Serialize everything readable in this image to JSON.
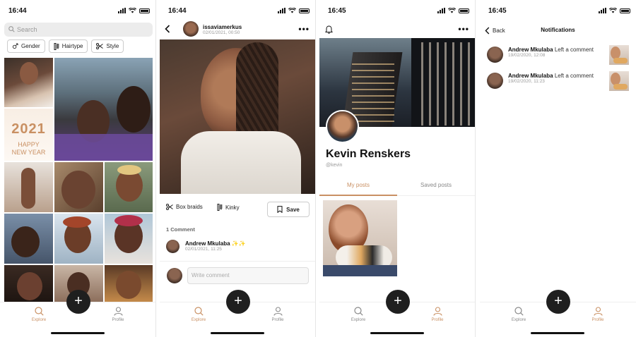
{
  "screens": {
    "explore": {
      "status_time": "16:44",
      "search_placeholder": "Search",
      "filters": [
        "Gender",
        "Hairtype",
        "Style"
      ],
      "banner_year": "2021",
      "banner_line1": "HAPPY",
      "banner_line2": "NEW YEAR"
    },
    "post": {
      "status_time": "16:44",
      "username": "issaviamerkus",
      "date": "02/01/2021, 00:50",
      "tags": [
        "Box braids",
        "Kinky"
      ],
      "save_label": "Save",
      "comments_count": "1 Comment",
      "comment": {
        "author": "Andrew Mkulaba",
        "text": "✨✨",
        "date": "02/01/2021, 11:25"
      },
      "write_placeholder": "Write comment"
    },
    "profile": {
      "status_time": "16:45",
      "name": "Kevin Renskers",
      "handle": "@kevin",
      "tabs": [
        "My posts",
        "Saved posts"
      ]
    },
    "notifications": {
      "status_time": "16:45",
      "back_label": "Back",
      "title": "Notifications",
      "items": [
        {
          "author": "Andrew Mkulaba",
          "message": "Left a comment",
          "date": "19/02/2020, 12:08"
        },
        {
          "author": "Andrew Mkulaba",
          "message": "Left a comment",
          "date": "19/02/2020, 11:23"
        }
      ]
    }
  },
  "tabbar": {
    "explore_label": "Explore",
    "profile_label": "Profile",
    "add_symbol": "+"
  },
  "colors": {
    "accent": "#c99063",
    "fab": "#1f1f1f",
    "search_bg": "#ececec"
  },
  "icons": [
    "search-icon",
    "gender-icon",
    "hairtype-icon",
    "scissors-icon",
    "back-chevron-icon",
    "more-icon",
    "bell-icon",
    "bookmark-icon",
    "plus-icon",
    "user-icon"
  ]
}
